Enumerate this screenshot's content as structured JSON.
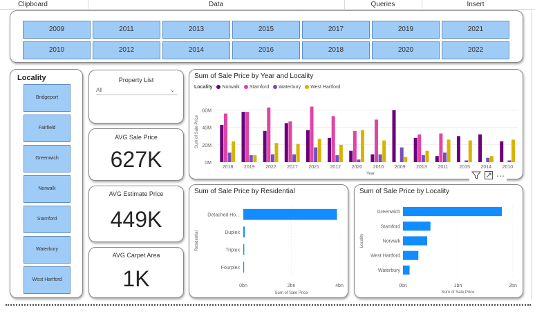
{
  "ribbon": {
    "groups": [
      "Clipboard",
      "Data",
      "Queries",
      "Insert"
    ]
  },
  "year_slicer": {
    "row1": [
      "2009",
      "2011",
      "2013",
      "2015",
      "2017",
      "2019",
      "2021"
    ],
    "row2": [
      "2010",
      "2012",
      "2014",
      "2016",
      "2018",
      "2020",
      "2022"
    ],
    "button_color": "#9fcbf7"
  },
  "locality_slicer": {
    "title": "Locality",
    "items": [
      "Bridgeport",
      "Fairfield",
      "Greenwich",
      "Norwalk",
      "Stamford",
      "Waterbury",
      "West Hartford"
    ]
  },
  "property_list": {
    "title": "Property List",
    "selected": "All"
  },
  "cards": {
    "avg_sale_price": {
      "title": "AVG Sale Price",
      "value": "627K"
    },
    "avg_estimate_price": {
      "title": "AVG Estimate Price",
      "value": "449K"
    },
    "avg_carpet_area": {
      "title": "AVG Carpet Area",
      "value": "1K"
    }
  },
  "chart_data": [
    {
      "type": "bar",
      "title": "Sum of Sale Price by Year and Locality",
      "legend_title": "Locality",
      "xlabel": "Year",
      "ylabel": "Sum of Sale Price",
      "yticks": [
        "0M",
        "20M",
        "40M",
        "60M"
      ],
      "ylim": [
        0,
        70
      ],
      "categories": [
        "2018",
        "2019",
        "2022",
        "2017",
        "2021",
        "2012",
        "2020",
        "2016",
        "2009",
        "2013",
        "2011",
        "2015",
        "2014",
        "2010"
      ],
      "series": [
        {
          "name": "Norwalk",
          "color": "#6b007b",
          "values": [
            43,
            58,
            36,
            45,
            37,
            28,
            13,
            9,
            60,
            28,
            7,
            30,
            32,
            24
          ]
        },
        {
          "name": "Stamford",
          "color": "#e044a7",
          "values": [
            56,
            58,
            63,
            47,
            64,
            53,
            36,
            49,
            0,
            32,
            33,
            0,
            0,
            0
          ]
        },
        {
          "name": "Waterbury",
          "color": "#744ec2",
          "values": [
            11,
            8,
            9,
            9,
            17,
            8,
            3,
            9,
            17,
            8,
            11,
            2,
            5,
            2
          ]
        },
        {
          "name": "West Hartford",
          "color": "#d9b300",
          "values": [
            24,
            8,
            22,
            21,
            27,
            20,
            37,
            25,
            6,
            13,
            26,
            25,
            7,
            26
          ]
        }
      ]
    },
    {
      "type": "bar",
      "orientation": "horizontal",
      "title": "Sum of Sale Price by Residential",
      "xlabel": "Sum of Sale Price",
      "ylabel": "Residential",
      "xticks": [
        "0bn",
        "2bn",
        "4bn"
      ],
      "xlim": [
        0,
        4
      ],
      "categories": [
        "Detached Ho...",
        "Duplex",
        "Triplex",
        "Fourplex"
      ],
      "values": [
        3.9,
        0.06,
        0.04,
        0.02
      ],
      "color": "#118dff"
    },
    {
      "type": "bar",
      "orientation": "horizontal",
      "title": "Sum of Sale Price by Locality",
      "xlabel": "Sum of Sale Price",
      "ylabel": "Locality",
      "xticks": [
        "0bn",
        "1bn",
        "2bn"
      ],
      "xlim": [
        0,
        2
      ],
      "categories": [
        "Greenwich",
        "Stamford",
        "Norwalk",
        "West Hartford",
        "Waterbury"
      ],
      "values": [
        1.8,
        0.5,
        0.44,
        0.28,
        0.12
      ],
      "color": "#118dff"
    }
  ],
  "icons": {
    "filter": "filter-icon",
    "focus": "focus-mode-icon",
    "more": "more-options-icon"
  }
}
